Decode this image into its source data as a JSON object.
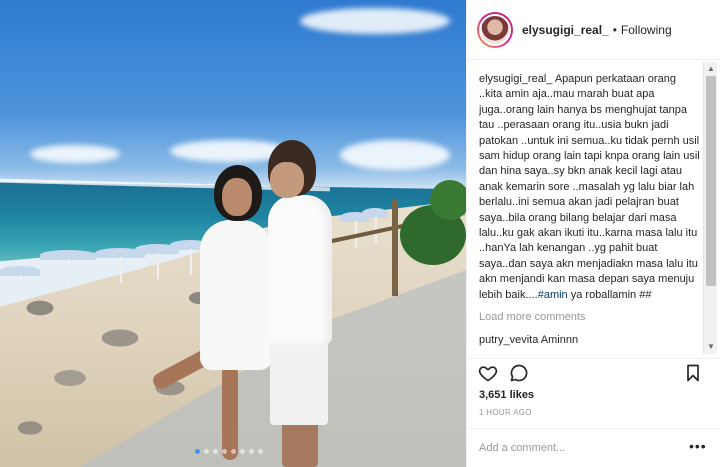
{
  "post": {
    "username": "elysugigi_real_",
    "follow_separator": "•",
    "follow_status": "Following",
    "caption_user": "elysugigi_real_",
    "caption_text": " Apapun perkataan orang ..kita amin aja..mau marah buat apa juga..orang lain hanya bs menghujat tanpa tau ..perasaan orang itu..usia bukn jadi patokan ..untuk ini semua..ku tidak pernh usil sam hidup orang lain tapi knpa orang lain usil dan hina saya..sy bkn anak kecil lagi atau anak kemarin sore ..masalah yg lalu biar lah berlalu..ini semua akan jadi pelajran buat saya..bila orang bilang belajar dari masa lalu..ku gak akan ikuti itu..karna masa lalu itu ..hanYa lah kenangan ..yg pahit buat saya..dan saya akn menjadiakn masa lalu itu akn menjandi kan masa depan saya menuju lebih baik....",
    "caption_hashtag": "#amin",
    "caption_end": " ya roballamin ##",
    "load_more": "Load more comments",
    "comment_user": "putry_vevita",
    "comment_text": " Aminnn",
    "likes": "3,651 likes",
    "timestamp": "1 HOUR AGO",
    "add_comment_placeholder": "Add a comment...",
    "more_options": "•••"
  },
  "carousel": {
    "count": 8,
    "active_index": 0
  },
  "icons": {
    "like": "heart-icon",
    "comment": "comment-bubble-icon",
    "save": "bookmark-icon",
    "scroll_up": "scroll-up-arrow-icon",
    "scroll_down": "scroll-down-arrow-icon"
  },
  "colors": {
    "text": "#262626",
    "muted": "#999999",
    "hashtag": "#003569",
    "carousel_active": "#3897f0",
    "avatar_ring": "#d6249f"
  }
}
